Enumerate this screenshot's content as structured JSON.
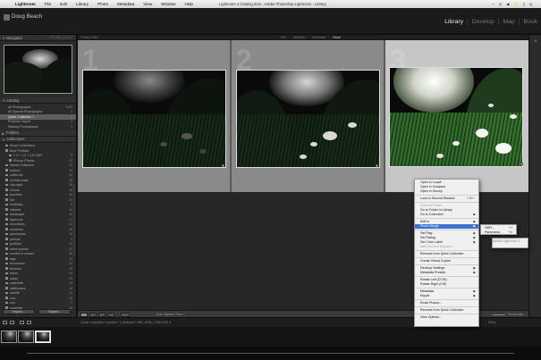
{
  "menubar": {
    "app": "Lightroom",
    "items": [
      "File",
      "Edit",
      "Library",
      "Photo",
      "Metadata",
      "View",
      "Window",
      "Help"
    ],
    "window_title": "Lightroom 4 Catalog.lrcat - Adobe Photoshop Lightroom - Library",
    "status": "⌁ ◷ ◀ ⚡ ▯ Q"
  },
  "identity": {
    "subtitle": "Adobe Lightroom 4",
    "name": "Doug Beach"
  },
  "modules": {
    "items": [
      {
        "label": "Library",
        "active": true
      },
      {
        "label": "Develop",
        "active": false
      },
      {
        "label": "Map",
        "active": false
      },
      {
        "label": "Book",
        "active": false
      }
    ]
  },
  "left_panel": {
    "navigator": {
      "title": "Navigator",
      "zoom": "FIT  FILL  1:1  3:1"
    },
    "catalog": {
      "title": "Catalog",
      "rows": [
        {
          "label": "All Photographs",
          "count": "1432",
          "selected": false
        },
        {
          "label": "All Synced Photographs",
          "count": "0",
          "selected": false
        },
        {
          "label": "Quick Collection +",
          "count": "3",
          "selected": true
        },
        {
          "label": "Previous Import",
          "count": "3",
          "selected": false
        },
        {
          "label": "Missing Photographs",
          "count": "1",
          "selected": false
        }
      ]
    },
    "folders": {
      "title": "Folders"
    },
    "collections": {
      "title": "Collections",
      "rows": [
        {
          "label": "Smart Collections",
          "count": "",
          "depth": 1
        },
        {
          "label": "Best Portfolio",
          "count": "",
          "depth": 1
        },
        {
          "label": "1.1 + 1.2 + 1.8 HDR",
          "count": "9",
          "depth": 2
        },
        {
          "label": "iPhone Photos",
          "count": "27",
          "depth": 2
        },
        {
          "label": "Saved Collection",
          "count": "12",
          "depth": 1
        },
        {
          "label": "balloon",
          "count": "31",
          "depth": 1
        },
        {
          "label": "california",
          "count": "44",
          "depth": 1
        },
        {
          "label": "central coast",
          "count": "18",
          "depth": 1
        },
        {
          "label": "city night",
          "count": "26",
          "depth": 1
        },
        {
          "label": "clouds",
          "count": "15",
          "depth": 1
        },
        {
          "label": "favorites",
          "count": "60",
          "depth": 1
        },
        {
          "label": "hdr",
          "count": "23",
          "depth": 1
        },
        {
          "label": "lensbaby",
          "count": "9",
          "depth": 1
        },
        {
          "label": "infrared",
          "count": "12",
          "depth": 1
        },
        {
          "label": "landscape",
          "count": "40",
          "depth": 1
        },
        {
          "label": "lightroom",
          "count": "17",
          "depth": 1
        },
        {
          "label": "mountains",
          "count": "22",
          "depth": 1
        },
        {
          "label": "monterey",
          "count": "29",
          "depth": 1
        },
        {
          "label": "panoramas",
          "count": "14",
          "depth": 1
        },
        {
          "label": "pinhole",
          "count": "8",
          "depth": 1
        },
        {
          "label": "portfolio",
          "count": "33",
          "depth": 1
        },
        {
          "label": "street photos",
          "count": "20",
          "depth": 1
        },
        {
          "label": "sunrise & sunset",
          "count": "36",
          "depth": 1
        },
        {
          "label": "tags",
          "count": "11",
          "depth": 1
        },
        {
          "label": "tennessee",
          "count": "24",
          "depth": 1
        },
        {
          "label": "textures",
          "count": "18",
          "depth": 1
        },
        {
          "label": "travel",
          "count": "41",
          "depth": 1
        },
        {
          "label": "water",
          "count": "19",
          "depth": 1
        },
        {
          "label": "waterfalls",
          "count": "13",
          "depth": 1
        },
        {
          "label": "wildflowers",
          "count": "16",
          "depth": 1
        },
        {
          "label": "wildlife",
          "count": "21",
          "depth": 1
        },
        {
          "label": "zion",
          "count": "10",
          "depth": 1
        },
        {
          "label": "zoo",
          "count": "7",
          "depth": 1
        },
        {
          "label": "yosemite",
          "count": "28",
          "depth": 1
        }
      ]
    },
    "import_label": "Import...",
    "export_label": "Export..."
  },
  "grid": {
    "header_left": "Library Filter",
    "filters": [
      {
        "label": "Text",
        "on": false
      },
      {
        "label": "Attribute",
        "on": false
      },
      {
        "label": "Metadata",
        "on": false
      },
      {
        "label": "None",
        "on": true
      }
    ],
    "cells": [
      {
        "number": "1",
        "selected": false
      },
      {
        "number": "2",
        "selected": false
      },
      {
        "number": "3",
        "selected": true
      }
    ]
  },
  "context_menu": {
    "items": [
      {
        "label": "Open in Loupe",
        "type": "item"
      },
      {
        "label": "Open in Compare",
        "type": "item"
      },
      {
        "label": "Open in Survey",
        "type": "item"
      },
      {
        "type": "sep"
      },
      {
        "label": "Lock to Second Window",
        "shortcut": "⇧⌘↵",
        "type": "item"
      },
      {
        "type": "sep"
      },
      {
        "label": "Show in Finder",
        "type": "dis"
      },
      {
        "label": "Go to Folder in Library",
        "type": "item"
      },
      {
        "label": "Go to Collection",
        "type": "sub"
      },
      {
        "type": "sep"
      },
      {
        "label": "Edit In",
        "type": "sub"
      },
      {
        "label": "Photo Merge",
        "type": "hl"
      },
      {
        "type": "sep"
      },
      {
        "label": "Set Flag",
        "type": "sub"
      },
      {
        "label": "Set Rating",
        "type": "sub"
      },
      {
        "label": "Set Color Label",
        "type": "sub"
      },
      {
        "label": "Add Shortcut Keyword",
        "type": "dis"
      },
      {
        "type": "sep"
      },
      {
        "label": "Remove from Quick Collection",
        "type": "item"
      },
      {
        "type": "sep"
      },
      {
        "label": "Create Virtual Copies",
        "type": "item"
      },
      {
        "type": "sep"
      },
      {
        "label": "Develop Settings",
        "type": "sub"
      },
      {
        "label": "Metadata Presets",
        "type": "sub"
      },
      {
        "type": "sep"
      },
      {
        "label": "Rotate Left (CCW)",
        "type": "item"
      },
      {
        "label": "Rotate Right (CW)",
        "type": "item"
      },
      {
        "type": "sep"
      },
      {
        "label": "Metadata",
        "type": "sub"
      },
      {
        "label": "Export",
        "type": "sub"
      },
      {
        "type": "sep"
      },
      {
        "label": "Email Photos...",
        "type": "item"
      },
      {
        "type": "sep"
      },
      {
        "label": "Remove from Quick Collection",
        "type": "item"
      },
      {
        "type": "sep"
      },
      {
        "label": "View Options...",
        "type": "item"
      }
    ],
    "submenu": [
      {
        "label": "HDR...",
        "shortcut": "^H"
      },
      {
        "label": "Panorama...",
        "shortcut": "^M"
      }
    ]
  },
  "toolbar": {
    "sort_label": "Sort: Capture Time ÷",
    "thumbnails_label": "Thumbnails"
  },
  "filmstrip": {
    "path": "Quick Collection   3 photos / 1 selected / IMG_8236_1200.CR2 ▾",
    "filter": "Filter:",
    "thumbs": [
      {
        "selected": false
      },
      {
        "selected": false
      },
      {
        "selected": true
      }
    ]
  }
}
